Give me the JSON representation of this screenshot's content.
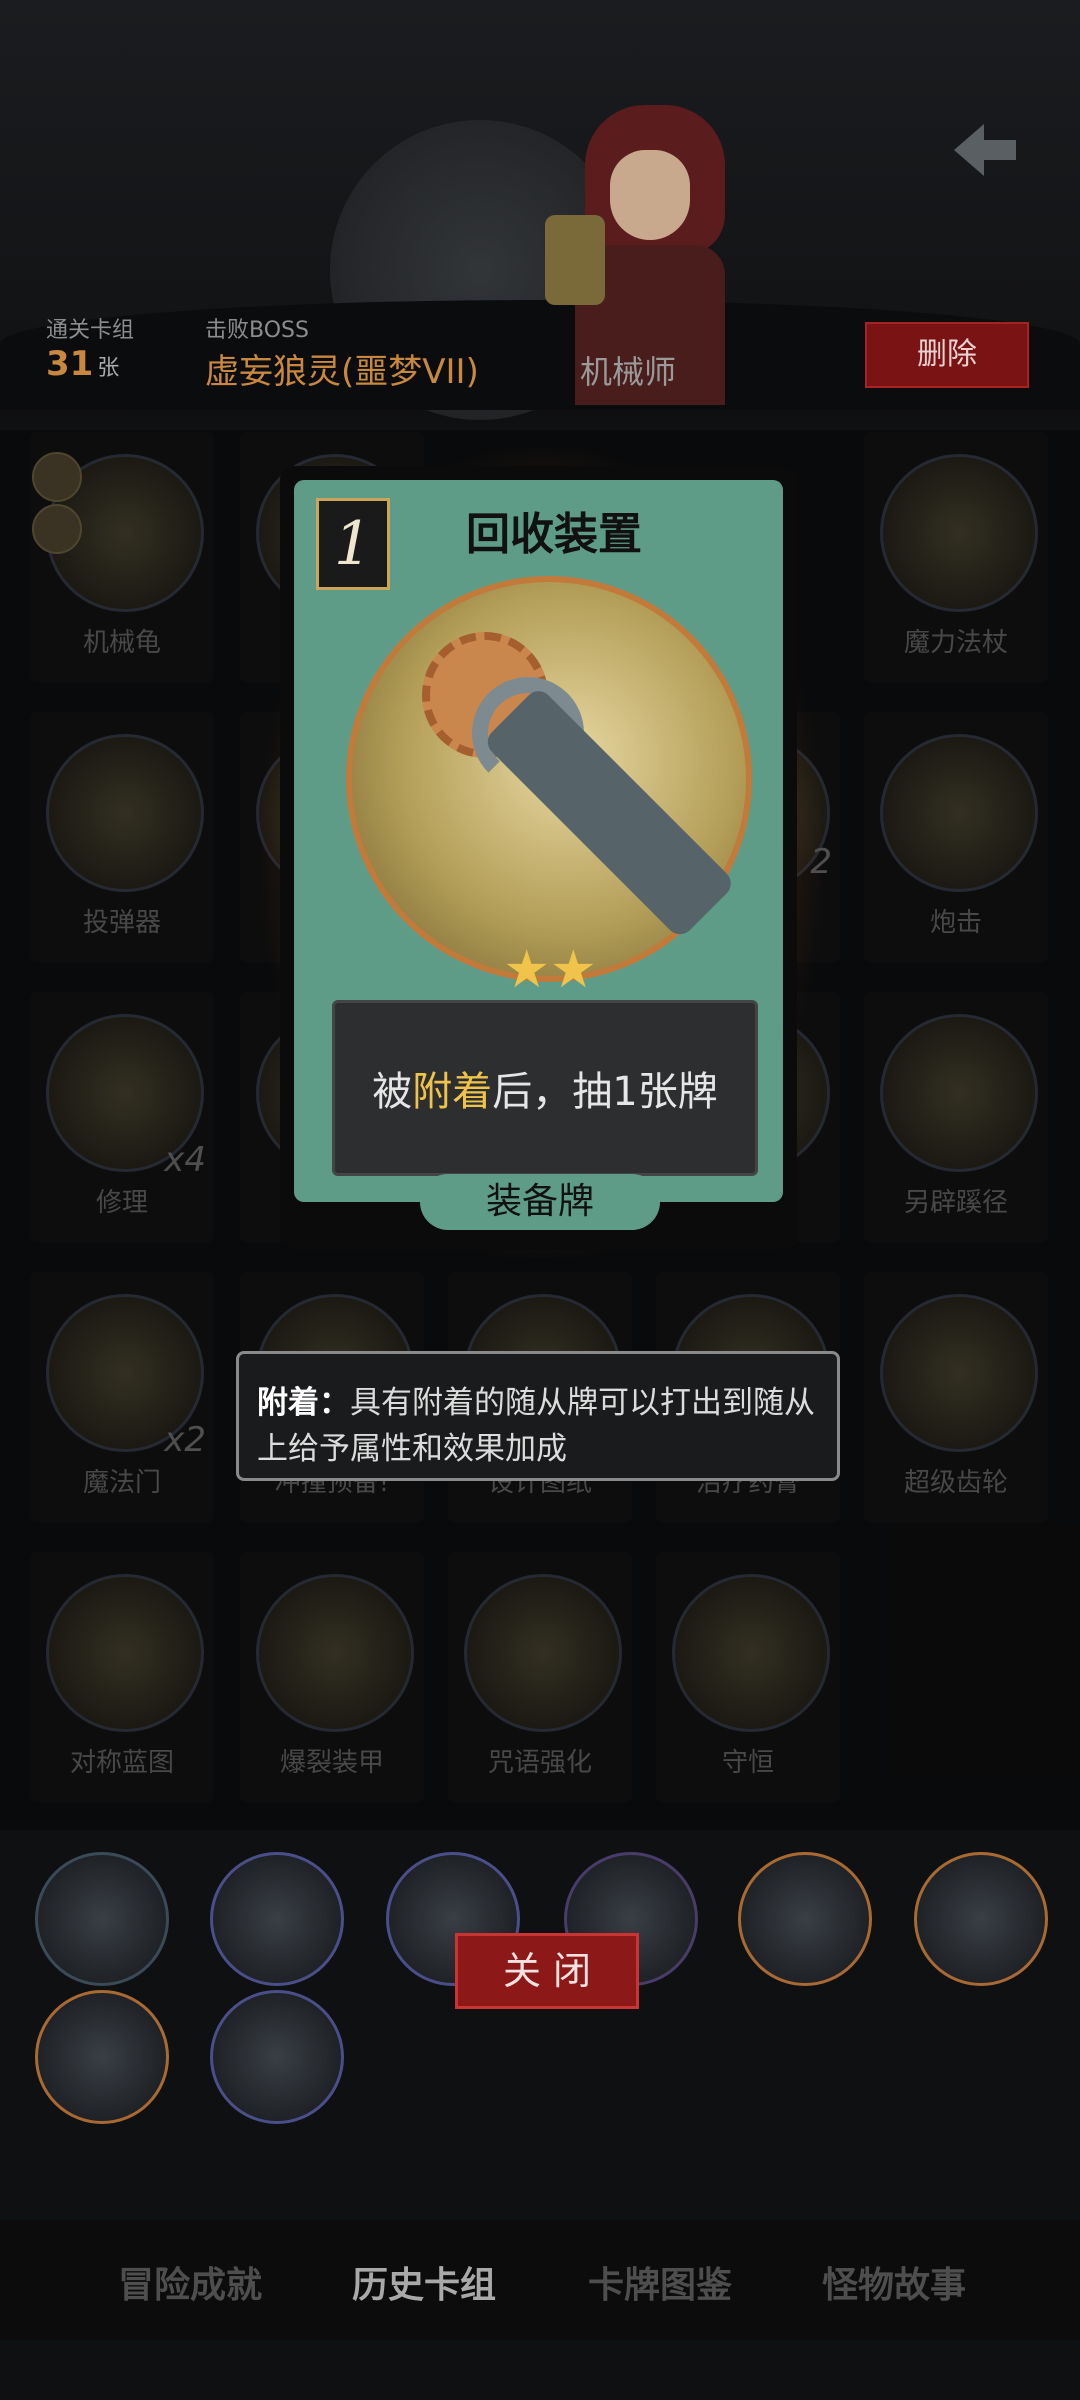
{
  "header": {
    "cleared_label": "通关卡组",
    "cleared_value": "31",
    "cleared_unit": "张",
    "boss_label": "击败BOSS",
    "boss_value": "虚妄狼灵(噩梦VII)",
    "class_name": "机械师",
    "delete_label": "删除"
  },
  "grid": {
    "items": [
      {
        "label": "机械龟"
      },
      {
        "label": "魔力法杖"
      },
      {
        "label": "投弹器"
      },
      {
        "label": "炮击"
      },
      {
        "label": "修理",
        "count": "x4"
      },
      {
        "label": "另辟蹊径"
      },
      {
        "label": "魔法门",
        "count": "x2"
      },
      {
        "label": "冲撞预备!"
      },
      {
        "label": "设计图纸"
      },
      {
        "label": "治疗药膏"
      },
      {
        "label": "超级齿轮"
      },
      {
        "label": "对称蓝图"
      },
      {
        "label": "爆裂装甲"
      },
      {
        "label": "咒语强化"
      },
      {
        "label": "守恒"
      }
    ],
    "partial_count": "2"
  },
  "card": {
    "cost": "1",
    "title": "回收装置",
    "stars": "★★",
    "desc_before": "被",
    "desc_highlight": "附着",
    "desc_after": "后，抽1张牌",
    "type": "装备牌"
  },
  "tooltip": {
    "term": "附着：",
    "text": "具有附着的随从牌可以打出到随从上给予属性和效果加成"
  },
  "close_label": "关 闭",
  "tabs": [
    "冒险成就",
    "历史卡组",
    "卡牌图鉴",
    "怪物故事"
  ],
  "active_tab_index": 1,
  "colors": {
    "accent_gold": "#c9883f",
    "highlight_yellow": "#f0c44a",
    "card_teal": "#5e9c88",
    "danger_red": "#8c1818"
  }
}
